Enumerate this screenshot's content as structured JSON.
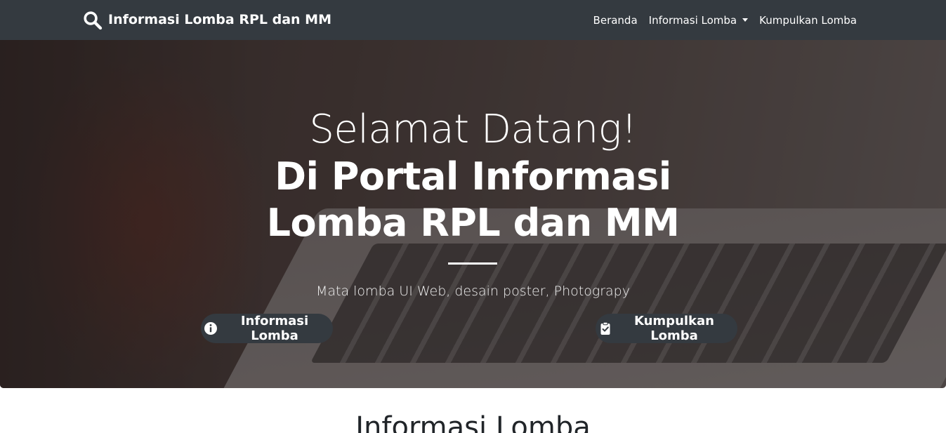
{
  "navbar": {
    "brand": "Informasi Lomba RPL dan MM",
    "brand_icon": "search-icon",
    "links": [
      {
        "label": "Beranda"
      },
      {
        "label": "Informasi Lomba",
        "dropdown": true
      },
      {
        "label": "Kumpulkan Lomba"
      }
    ]
  },
  "hero": {
    "welcome": "Selamat Datang!",
    "title": "Di Portal Informasi Lomba RPL dan MM",
    "subtitle": "Mata lomba UI Web, desain poster, Photograpy",
    "buttons": [
      {
        "label": "Informasi Lomba",
        "icon": "info-circle-icon"
      },
      {
        "label": "Kumpulkan Lomba",
        "icon": "clipboard-check-icon"
      }
    ]
  },
  "section": {
    "title": "Informasi Lomba"
  },
  "colors": {
    "navbar": "#343a40",
    "button": "#343a40",
    "text_light": "#ffffff"
  }
}
